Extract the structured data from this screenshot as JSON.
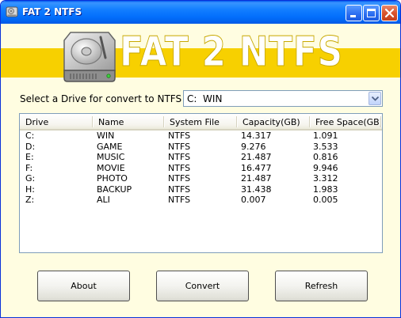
{
  "window": {
    "title": "FAT 2 NTFS",
    "accent_color": "#0058ee",
    "close_color": "#d9542d",
    "background_color": "#fffde1"
  },
  "banner": {
    "title": "FAT 2 NTFS",
    "stripe_color": "#f7d000",
    "icon": "hard-drive-icon"
  },
  "drive_selector": {
    "label": "Select a Drive for convert to NTFS :",
    "selected_value": "C:  WIN"
  },
  "drive_list": {
    "columns": [
      "Drive",
      "Name",
      "System File",
      "Capacity(GB)",
      "Free Space(GB)"
    ],
    "rows": [
      [
        "C:",
        "WIN",
        "NTFS",
        "14.317",
        "1.091"
      ],
      [
        "D:",
        "GAME",
        "NTFS",
        "9.276",
        "3.533"
      ],
      [
        "E:",
        "MUSIC",
        "NTFS",
        "21.487",
        "0.816"
      ],
      [
        "F:",
        "MOVIE",
        "NTFS",
        "16.477",
        "9.946"
      ],
      [
        "G:",
        "PHOTO",
        "NTFS",
        "21.487",
        "3.312"
      ],
      [
        "H:",
        "BACKUP",
        "NTFS",
        "31.438",
        "1.983"
      ],
      [
        "Z:",
        "ALI",
        "NTFS",
        "0.007",
        "0.005"
      ]
    ]
  },
  "buttons": {
    "about": "About",
    "convert": "Convert",
    "refresh": "Refresh"
  }
}
